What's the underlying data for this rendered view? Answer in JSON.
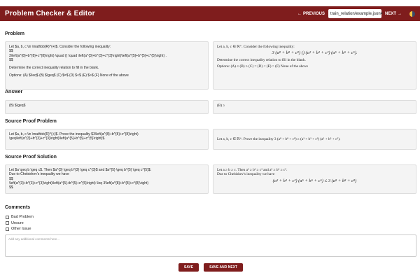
{
  "header": {
    "title": "Problem Checker & Editor",
    "previous_label": "PREVIOUS",
    "next_label": "NEXT",
    "file_value": "train_relation/example.json"
  },
  "sections": {
    "problem": {
      "title": "Problem",
      "source_lines": [
        "Let $a, b, c \\in \\mathbb{R}^{+}$. Consider the following inequality:",
        "$$",
        "3\\left(a^{8}+b^{8}+c^{8}\\right) \\quad () \\quad \\left(a^{3}+b^{3}+c^{3}\\right)\\left(a^{5}+b^{5}+c^{5}\\right) .",
        "$$",
        "",
        "Determine the correct inequality relation to fill in the blank.",
        "",
        "Options: (A) $\\leq$  (B) $\\geq$  (C) $=$  (D) $<$  (E) $>$  (F) None of the above"
      ],
      "rendered_intro": "Let a, b, c ∈ ℝ⁺. Consider the following inequality:",
      "rendered_math": "3 (a⁸ + b⁸ + c⁸)    ()    (a³ + b³ + c³) (a⁵ + b⁵ + c⁵).",
      "rendered_instruction": "Determine the correct inequality relation to fill in the blank.",
      "rendered_options": "Options: (A) ≤ (B) ≥ (C) = (D) < (E) > (F) None of the above"
    },
    "answer": {
      "title": "Answer",
      "source": "(B) $\\geq$",
      "rendered": "(B) ≥"
    },
    "source_problem": {
      "title": "Source Proof Problem",
      "source_lines": [
        "Let $a, b, c \\in \\mathbb{R}^{+}$. Prove the inequality $3\\left(a^{8}+b^{8}+c^{8}\\right)",
        "\\geq\\left(a^{3}+b^{3}+c^{3}\\right)\\left(a^{5}+b^{5}+c^{5}\\right)$."
      ],
      "rendered": "Let a, b, c ∈ ℝ⁺. Prove the inequality 3 (a⁸ + b⁸ + c⁸) ≥ (a³ + b³ + c³) (a⁵ + b⁵ + c⁵)."
    },
    "source_solution": {
      "title": "Source Proof Solution",
      "source_lines": [
        "Let $a \\geq b \\geq c$. Then $a^{3} \\geq b^{3} \\geq c^{3}$ and $a^{5} \\geq b^{5} \\geq c^{5}$.",
        "Due to Chebishev's inequality we have",
        "$$",
        "\\left(a^{3}+b^{3}+c^{3}\\right)\\left(a^{5}+b^{5}+c^{5}\\right) \\leq 3\\left(a^{8}+b^{8}+c^{8}\\right)",
        "$$"
      ],
      "rendered_line1": "Let a ≥ b ≥ c. Then a³ ≥ b³ ≥ c³ and a⁵ ≥ b⁵ ≥ c⁵.",
      "rendered_line2": "Due to Chebishev's inequality we have",
      "rendered_math": "(a³ + b³ + c³) (a⁵ + b⁵ + c⁵) ≤ 3 (a⁸ + b⁸ + c⁸)"
    }
  },
  "comments": {
    "title": "Comments",
    "options": [
      "Bad Problem",
      "Unsure",
      "Other Issue"
    ],
    "placeholder": "Add any additional comments here..."
  },
  "actions": {
    "save_label": "SAVE",
    "save_next_label": "SAVE AND NEXT"
  },
  "colors": {
    "brand": "#7f1d1d",
    "panel_bg": "#f4f4f4"
  }
}
